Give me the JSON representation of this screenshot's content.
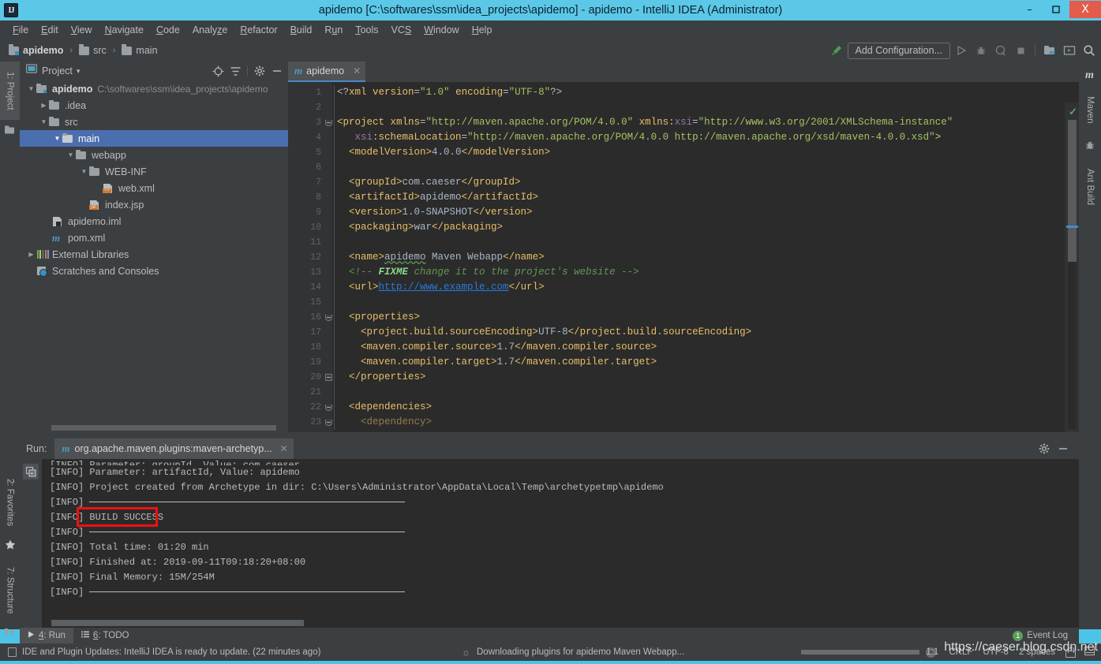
{
  "window": {
    "title": "apidemo [C:\\softwares\\ssm\\idea_projects\\apidemo] - apidemo - IntelliJ IDEA (Administrator)",
    "logo": "IJ",
    "minimize": "–",
    "maximize": "❐",
    "close": "X",
    "accent": "#4ec3e8"
  },
  "menu": {
    "items": [
      "File",
      "Edit",
      "View",
      "Navigate",
      "Code",
      "Analyze",
      "Refactor",
      "Build",
      "Run",
      "Tools",
      "VCS",
      "Window",
      "Help"
    ]
  },
  "navbar": {
    "breadcrumbs": [
      {
        "label": "apidemo",
        "icon": "module-icon"
      },
      {
        "label": "src",
        "icon": "folder-icon"
      },
      {
        "label": "main",
        "icon": "folder-icon"
      }
    ],
    "separator": "›",
    "add_configuration": "Add Configuration...",
    "icons": [
      "hammer-icon",
      "run-icon",
      "debug-icon",
      "run-coverage-icon",
      "stop-icon",
      "project-structure-icon",
      "select-run-icon",
      "search-icon"
    ]
  },
  "left_strip": {
    "tabs": [
      {
        "label": "1: Project",
        "icon": "project-icon",
        "active": true
      },
      {
        "label": "2: Favorites",
        "icon": "star-icon",
        "active": false
      },
      {
        "label": "7: Structure",
        "icon": "structure-icon",
        "active": false
      }
    ]
  },
  "right_strip": {
    "tabs": [
      {
        "label": "Maven",
        "icon": "maven-icon"
      },
      {
        "label": "Ant Build",
        "icon": "ant-icon"
      }
    ]
  },
  "project_panel": {
    "title": "Project",
    "dropdown": "▾",
    "header_icons": [
      "locate-icon",
      "collapse-all-icon",
      "gear-icon",
      "hide-icon"
    ],
    "tree": [
      {
        "label": "apidemo",
        "suffix": "C:\\softwares\\ssm\\idea_projects\\apidemo",
        "depth": 0,
        "arrow": "▼",
        "icon": "module-icon",
        "bold": true,
        "selected": false
      },
      {
        "label": ".idea",
        "suffix": "",
        "depth": 1,
        "arrow": "▶",
        "icon": "folder-icon",
        "bold": false,
        "selected": false
      },
      {
        "label": "src",
        "suffix": "",
        "depth": 1,
        "arrow": "▼",
        "icon": "folder-icon",
        "bold": false,
        "selected": false
      },
      {
        "label": "main",
        "suffix": "",
        "depth": 2,
        "arrow": "▼",
        "icon": "folder-icon",
        "bold": false,
        "selected": true
      },
      {
        "label": "webapp",
        "suffix": "",
        "depth": 3,
        "arrow": "▼",
        "icon": "folder-icon",
        "bold": false,
        "selected": false
      },
      {
        "label": "WEB-INF",
        "suffix": "",
        "depth": 4,
        "arrow": "▼",
        "icon": "folder-icon",
        "bold": false,
        "selected": false
      },
      {
        "label": "web.xml",
        "suffix": "",
        "depth": 5,
        "arrow": "",
        "icon": "xml-file-icon",
        "bold": false,
        "selected": false
      },
      {
        "label": "index.jsp",
        "suffix": "",
        "depth": 4,
        "arrow": "",
        "icon": "jsp-file-icon",
        "bold": false,
        "selected": false
      },
      {
        "label": "apidemo.iml",
        "suffix": "",
        "depth": 2,
        "arrow": "",
        "icon": "iml-file-icon",
        "bold": false,
        "selected": false
      },
      {
        "label": "pom.xml",
        "suffix": "",
        "depth": 2,
        "arrow": "",
        "icon": "maven-pom-icon",
        "bold": false,
        "selected": false
      },
      {
        "label": "External Libraries",
        "suffix": "",
        "depth": 0,
        "arrow": "▶",
        "icon": "libraries-icon",
        "bold": false,
        "selected": false
      },
      {
        "label": "Scratches and Consoles",
        "suffix": "",
        "depth": 0,
        "arrow": "",
        "icon": "scratches-icon",
        "bold": false,
        "selected": false
      }
    ]
  },
  "editor": {
    "tab": {
      "label": "apidemo",
      "icon": "maven-icon",
      "close": "✕"
    },
    "line_numbers": [
      "1",
      "2",
      "3",
      "4",
      "5",
      "6",
      "7",
      "8",
      "9",
      "10",
      "11",
      "12",
      "13",
      "14",
      "15",
      "16",
      "17",
      "18",
      "19",
      "20",
      "21",
      "22",
      "23"
    ],
    "lines": [
      "<?xml version=\"1.0\" encoding=\"UTF-8\"?>",
      "",
      "<project xmlns=\"http://maven.apache.org/POM/4.0.0\" xmlns:xsi=\"http://www.w3.org/2001/XMLSchema-instance\"",
      "   xsi:schemaLocation=\"http://maven.apache.org/POM/4.0.0 http://maven.apache.org/xsd/maven-4.0.0.xsd\">",
      "  <modelVersion>4.0.0</modelVersion>",
      "",
      "  <groupId>com.caeser</groupId>",
      "  <artifactId>apidemo</artifactId>",
      "  <version>1.0-SNAPSHOT</version>",
      "  <packaging>war</packaging>",
      "",
      "  <name>apidemo Maven Webapp</name>",
      "  <!-- FIXME change it to the project's website -->",
      "  <url>http://www.example.com</url>",
      "",
      "  <properties>",
      "    <project.build.sourceEncoding>UTF-8</project.build.sourceEncoding>",
      "    <maven.compiler.source>1.7</maven.compiler.source>",
      "    <maven.compiler.target>1.7</maven.compiler.target>",
      "  </properties>",
      "",
      "  <dependencies>",
      "    <dependency>"
    ]
  },
  "run_panel": {
    "label": "Run:",
    "tab": {
      "label": "org.apache.maven.plugins:maven-archetyp...",
      "icon": "maven-icon",
      "close": "✕"
    },
    "header_icons": [
      "gear-icon",
      "hide-icon"
    ],
    "gutter_icon": "soft-wrap-icon",
    "console_lines": [
      "[INFO] Parameter: groupId, Value: com.caeser",
      "[INFO] Parameter: artifactId, Value: apidemo",
      "[INFO] Project created from Archetype in dir: C:\\Users\\Administrator\\AppData\\Local\\Temp\\archetypetmp\\apidemo",
      "[INFO] ------------------------------------------------------------------------",
      "[INFO] BUILD SUCCESS",
      "[INFO] ------------------------------------------------------------------------",
      "[INFO] Total time: 01:20 min",
      "[INFO] Finished at: 2019-09-11T09:18:20+08:00",
      "[INFO] Final Memory: 15M/254M",
      "[INFO] ------------------------------------------------------------------------"
    ],
    "highlight": {
      "text": "BUILD SUCCESS",
      "color": "#ee1111"
    }
  },
  "bottom_tabs": {
    "tabs": [
      {
        "label": "4: Run",
        "icon": "run-icon",
        "active": true
      },
      {
        "label": "6: TODO",
        "icon": "todo-icon",
        "active": false
      }
    ],
    "event_log": {
      "label": "Event Log",
      "badge": "1",
      "badge_color": "#5a9e5a"
    }
  },
  "status_bar": {
    "message": "IDE and Plugin Updates: IntelliJ IDEA is ready to update. (22 minutes ago)",
    "progress_text": "Downloading plugins for apidemo Maven Webapp...",
    "cancel": "✕",
    "caret": "1:1",
    "line_separator": "CRLF",
    "encoding": "UTF-8",
    "indent": "2 spaces",
    "watermark": "https://caeser.blog.csdn.net"
  }
}
